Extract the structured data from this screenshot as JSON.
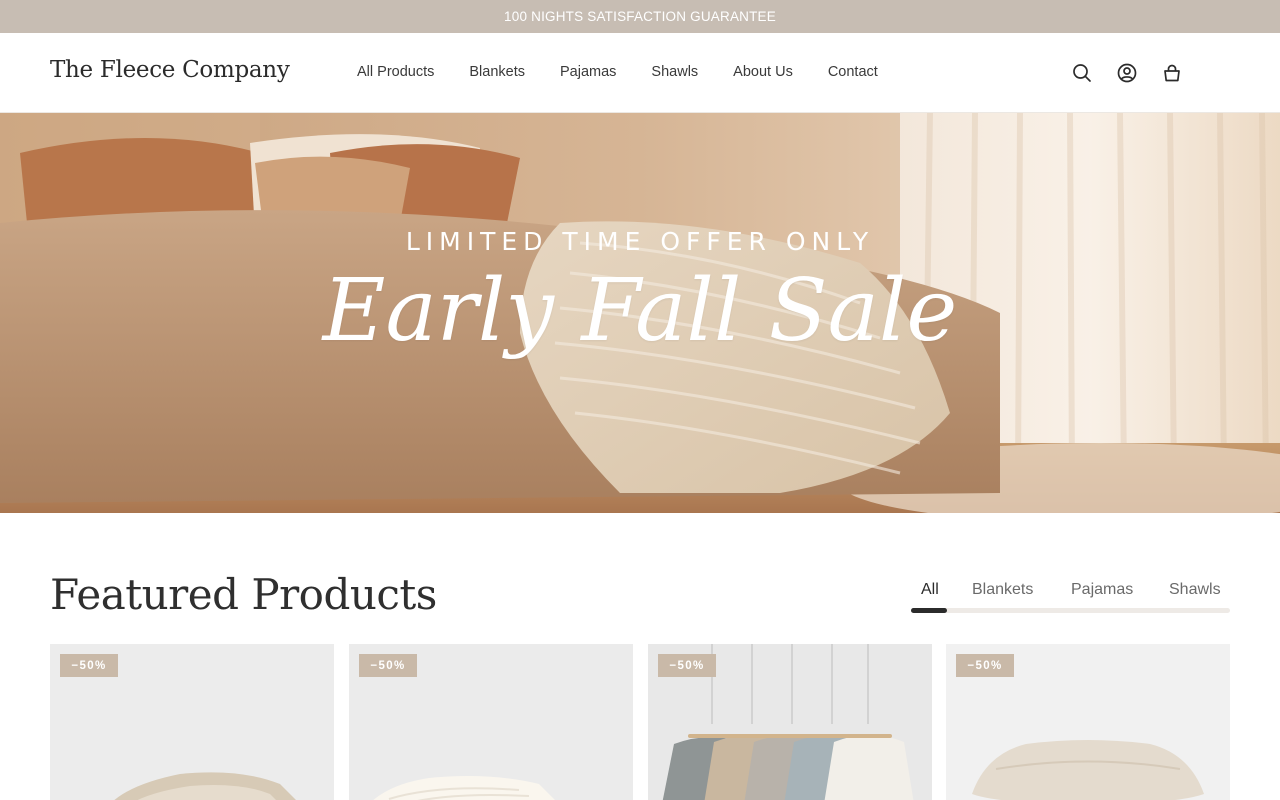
{
  "announcement": {
    "text": "100 NIGHTS SATISFACTION GUARANTEE"
  },
  "header": {
    "logo": "The Fleece Company",
    "nav": [
      {
        "label": "All Products"
      },
      {
        "label": "Blankets"
      },
      {
        "label": "Pajamas"
      },
      {
        "label": "Shawls"
      },
      {
        "label": "About Us"
      },
      {
        "label": "Contact"
      }
    ],
    "icons": [
      "search-icon",
      "account-icon",
      "cart-icon"
    ]
  },
  "hero": {
    "kicker": "LIMITED TIME OFFER ONLY",
    "headline": "Early Fall Sale"
  },
  "featured": {
    "title": "Featured Products",
    "tabs": [
      {
        "label": "All",
        "active": true
      },
      {
        "label": "Blankets",
        "active": false
      },
      {
        "label": "Pajamas",
        "active": false
      },
      {
        "label": "Shawls",
        "active": false
      }
    ],
    "products": [
      {
        "badge": "−50%",
        "image": "folded-knit-blanket"
      },
      {
        "badge": "−50%",
        "image": "cream-textured-blanket"
      },
      {
        "badge": "−50%",
        "image": "robes-on-hangers"
      },
      {
        "badge": "−50%",
        "image": "pillow"
      }
    ]
  },
  "colors": {
    "announcement_bg": "#c7bdb3",
    "badge_bg": "#c9b9a8",
    "text_dark": "#2b2b2b",
    "tab_indicator": "#2b2b2b"
  }
}
